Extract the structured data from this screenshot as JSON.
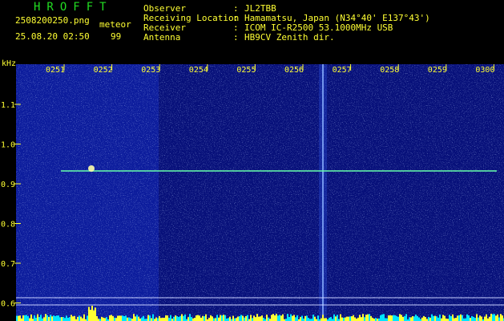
{
  "header": {
    "title": "HROFFT",
    "filename": "2508200250.png",
    "datetime": "25.08.20 02:50",
    "meteor_label": "meteor",
    "meteor_count": "99"
  },
  "station": [
    {
      "key": "Observer",
      "value": "JL2TBB"
    },
    {
      "key": "Receiving Location",
      "value": "Hamamatsu, Japan (N34°40' E137°43')"
    },
    {
      "key": "Receiver",
      "value": "ICOM IC-R2500 53.1000MHz USB"
    },
    {
      "key": "Antenna",
      "value": "HB9CV Zenith dir."
    }
  ],
  "separator": ":",
  "axis": {
    "y_unit": "kHz",
    "y_ticks": [
      "1.1",
      "1.0",
      "0.9",
      "0.8",
      "0.7",
      "0.6"
    ],
    "x_ticks": [
      "0251",
      "0252",
      "0253",
      "0254",
      "0255",
      "0256",
      "0257",
      "0258",
      "0259",
      "0300"
    ]
  },
  "colors": {
    "background": "#000000",
    "spectrum": "#0a1a8c",
    "label": "#ffff33",
    "title": "#22dd22",
    "trace": "#66ffaa",
    "baseline": "#00e5ff"
  }
}
